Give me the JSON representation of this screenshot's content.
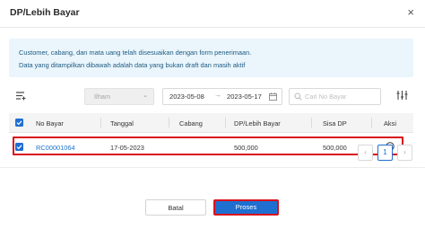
{
  "dialog": {
    "title": "DP/Lebih Bayar",
    "close_symbol": "×"
  },
  "info": {
    "line1": "Customer, cabang, dan mata uang telah disesuaikan dengan form penerimaan.",
    "line2": "Data yang ditampilkan dibawah adalah data yang bukan draft dan masih aktif"
  },
  "filters": {
    "user_select": "Ilham",
    "date_from": "2023-05-08",
    "date_to": "2023-05-17",
    "date_separator": "→",
    "search_placeholder": "Cari No Bayar"
  },
  "table": {
    "headers": [
      "No Bayar",
      "Tanggal",
      "Cabang",
      "DP/Lebih Bayar",
      "Sisa DP",
      "Aksi"
    ],
    "rows": [
      {
        "no_bayar": "RC00001064",
        "tanggal": "17-05-2023",
        "cabang": "",
        "dp": "500,000",
        "sisa": "500,000",
        "checked": true
      }
    ]
  },
  "pagination": {
    "current": "1",
    "prev": "‹",
    "next": "›"
  },
  "buttons": {
    "cancel": "Batal",
    "submit": "Proses"
  },
  "colors": {
    "primary": "#1f6fd1",
    "highlight": "#d9121b",
    "info_bg": "#eaf5fc"
  },
  "icons": [
    "close-icon",
    "filter-list-icon",
    "chevron-down-icon",
    "calendar-icon",
    "search-icon",
    "columns-settings-icon",
    "arrow-circle-right-icon",
    "chevron-left-icon",
    "chevron-right-icon"
  ]
}
